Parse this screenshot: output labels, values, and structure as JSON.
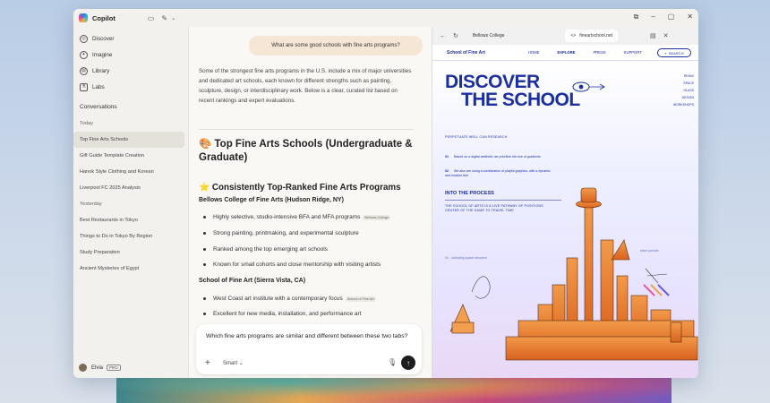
{
  "app": {
    "name": "Copilot"
  },
  "sidebar": {
    "nav": [
      {
        "label": "Discover",
        "icon": "compass-icon"
      },
      {
        "label": "Imagine",
        "icon": "image-icon"
      },
      {
        "label": "Library",
        "icon": "library-icon"
      },
      {
        "label": "Labs",
        "icon": "flask-icon"
      }
    ],
    "conversations_heading": "Conversations",
    "conversations": [
      {
        "label": "Today",
        "group": true
      },
      {
        "label": "Top Fine Arts Schools",
        "active": true
      },
      {
        "label": "Gift Guide Template Creation"
      },
      {
        "label": "Hanok Style Clothing and Korean"
      },
      {
        "label": "Liverpool FC 2025 Analysis"
      },
      {
        "label": "Yesterday",
        "group": true
      },
      {
        "label": "Best Restaurants in Tokyo"
      },
      {
        "label": "Things to Do in Tokyo By Region"
      },
      {
        "label": "Study Preparation"
      },
      {
        "label": "Ancient Mysteries of Egypt"
      }
    ],
    "user": {
      "name": "Elvia",
      "badge": "PRO"
    }
  },
  "chat": {
    "user_message": "What are some good schools with fine arts programs?",
    "intro": "Some of the strongest fine arts programs in the U.S. include a mix of major universities and dedicated art schools, each known for different strengths such as painting, sculpture, design, or interdisciplinary work. Below is a clear, curated list based on recent rankings and expert evaluations.",
    "heading": "🎨 Top Fine Arts Schools (Undergraduate & Graduate)",
    "subheading": "⭐ Consistently Top-Ranked Fine Arts Programs",
    "school1": {
      "name": "Bellows College of Fine Arts (Hudson Ridge, NY)",
      "bullets": [
        {
          "text": "Highly selective, studio-intensive BFA and MFA programs",
          "cite": "Bellows College"
        },
        {
          "text": "Strong painting, printmaking, and experimental sculpture"
        },
        {
          "text": "Ranked among the top emerging art schools"
        },
        {
          "text": "Known for small cohorts and close mentorship with visiting artists"
        }
      ]
    },
    "school2": {
      "name": "School of Fine Art (Sierra Vista, CA)",
      "bullets": [
        {
          "text": "West Coast art institute with a contemporary focus",
          "cite": "School of Fine Art"
        },
        {
          "text": "Excellent for new media, installation, and performance art"
        }
      ]
    },
    "composer": {
      "text": "Which fine arts programs are similar and different between these two tabs?",
      "mode": "Smart"
    }
  },
  "browser": {
    "tabs": [
      "Bellows College",
      "fineartschool.net"
    ],
    "site": {
      "logo": "School of Fine Art",
      "nav": [
        "HOME",
        "EXPLORE",
        "PRESS",
        "SUPPORT"
      ],
      "search": "SEARCH",
      "hero_line1": "DISCOVER",
      "hero_line2": "THE SCHOOL",
      "side_list": [
        "REMIX",
        "SPACE",
        "GLASS",
        "DESIGN",
        "WORKSHOPS"
      ],
      "caption": "PERPETUATE WELL CAN RESEARCH",
      "points": [
        {
          "num": "01",
          "text": "Based on a digital aesthetic we prioritize the use of gradients"
        },
        {
          "num": "02",
          "text": "We also are using a combination of playful graphics, with a dynamic and modern feel"
        }
      ],
      "section_title": "INTO THE PROCESS",
      "section_text": "THE SCHOOL OF ARTS IS A LIVE PATHWAY OF POSITIONS CENTER OF THE GAME TO TRAVEL TIME",
      "notes": [
        "01 - unfolding space structure",
        "silver pencils"
      ]
    }
  }
}
